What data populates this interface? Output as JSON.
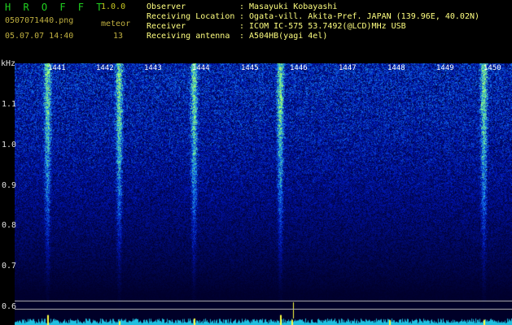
{
  "header": {
    "app_title": "H R O F F T",
    "version": "1.0.0",
    "filename": "0507071440.png",
    "datetime": "05.07.07 14:40",
    "meteor_label": "meteor",
    "meteor_count": "13"
  },
  "info": {
    "labels": [
      "Observer",
      "Receiving Location",
      "Receiver",
      "Receiving antenna"
    ],
    "values": [
      ": Masayuki Kobayashi",
      ": Ogata-vill. Akita-Pref. JAPAN (139.96E, 40.02N)",
      ": ICOM IC-575 53.7492(@LCD)MHz USB",
      ": A504HB(yagi 4el)"
    ]
  },
  "axis": {
    "unit": "kHz",
    "ticks": [
      "1.1",
      "1.0",
      "0.9",
      "0.8",
      "0.7",
      "0.6"
    ]
  },
  "minutes": [
    "1441",
    "1442",
    "1443",
    "1444",
    "1445",
    "1446",
    "1447",
    "1448",
    "1449",
    "1450"
  ],
  "colors": {
    "background": "#000000",
    "spectrum_base": "#0a1a8a",
    "echo": "#30e0a0",
    "baseline": "#20c0e0",
    "spike": "#ffff40"
  }
}
